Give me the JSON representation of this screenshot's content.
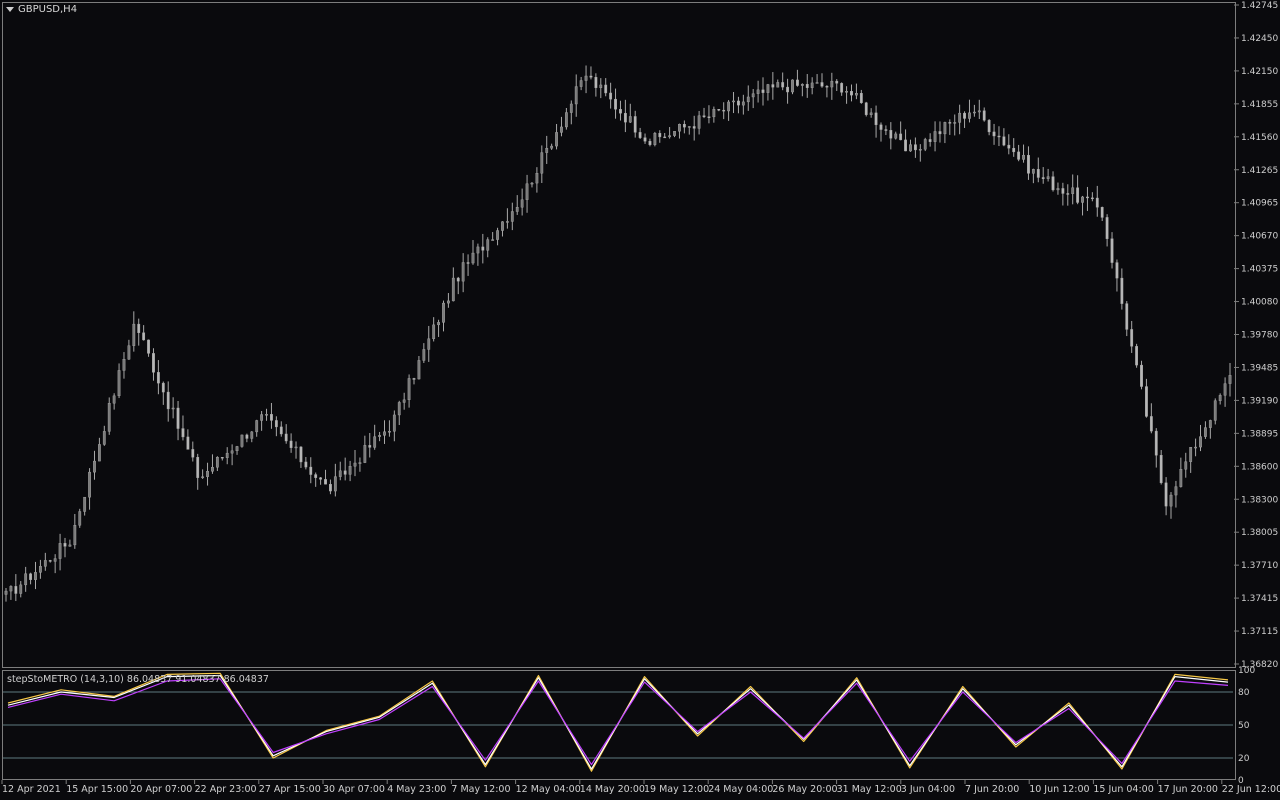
{
  "header": {
    "symbol_label": "GBPUSD,H4",
    "collapse_icon": "triangle-down-icon"
  },
  "indicator": {
    "label": "stepStoMETRO (14,3,10) 86.04837 91.04837 86.04837",
    "levels": [
      "100",
      "80",
      "50",
      "20",
      "0"
    ]
  },
  "price_axis": {
    "labels": [
      "1.42745",
      "1.42450",
      "1.42150",
      "1.41855",
      "1.41560",
      "1.41265",
      "1.40965",
      "1.40670",
      "1.40375",
      "1.40080",
      "1.39780",
      "1.39485",
      "1.39190",
      "1.38895",
      "1.38600",
      "1.38300",
      "1.38005",
      "1.37710",
      "1.37415",
      "1.37115",
      "1.36820"
    ]
  },
  "time_axis": {
    "labels": [
      "12 Apr 2021",
      "15 Apr 15:00",
      "20 Apr 07:00",
      "22 Apr 23:00",
      "27 Apr 15:00",
      "30 Apr 07:00",
      "4 May 23:00",
      "7 May 12:00",
      "12 May 04:00",
      "14 May 20:00",
      "19 May 12:00",
      "24 May 04:00",
      "26 May 20:00",
      "31 May 12:00",
      "3 Jun 04:00",
      "7 Jun 20:00",
      "10 Jun 12:00",
      "15 Jun 04:00",
      "17 Jun 20:00",
      "22 Jun 12:00"
    ]
  },
  "chart_data": [
    {
      "type": "candlestick",
      "title": "GBPUSD,H4",
      "ylim": [
        1.3682,
        1.42745
      ],
      "x": [
        "12 Apr 2021",
        "15 Apr 15:00",
        "20 Apr 07:00",
        "22 Apr 23:00",
        "27 Apr 15:00",
        "30 Apr 07:00",
        "4 May 23:00",
        "7 May 12:00",
        "12 May 04:00",
        "14 May 20:00",
        "19 May 12:00",
        "24 May 04:00",
        "26 May 20:00",
        "31 May 12:00",
        "3 Jun 04:00",
        "7 Jun 20:00",
        "10 Jun 12:00",
        "15 Jun 04:00",
        "17 Jun 20:00",
        "22 Jun 12:00"
      ],
      "close": [
        1.3745,
        1.3795,
        1.399,
        1.385,
        1.3905,
        1.384,
        1.39,
        1.403,
        1.41,
        1.421,
        1.415,
        1.4175,
        1.42,
        1.42,
        1.414,
        1.418,
        1.412,
        1.409,
        1.383,
        1.394
      ],
      "color": "#a9a9a9"
    },
    {
      "type": "line",
      "title": "stepStoMETRO (14,3,10) 86.04837 91.04837 86.04837",
      "ylim": [
        0,
        100
      ],
      "levels": [
        100,
        80,
        50,
        20,
        0
      ],
      "series": [
        {
          "color": "#f7c948",
          "values": [
            70,
            82,
            76,
            96,
            97,
            20,
            45,
            58,
            90,
            12,
            95,
            8,
            94,
            40,
            85,
            35,
            93,
            11,
            85,
            30,
            70,
            10,
            96,
            91
          ]
        },
        {
          "color": "#ffffff",
          "values": [
            68,
            80,
            75,
            94,
            95,
            22,
            44,
            57,
            88,
            14,
            93,
            10,
            92,
            42,
            83,
            37,
            91,
            13,
            83,
            32,
            68,
            12,
            94,
            89
          ]
        },
        {
          "color": "#c040ff",
          "values": [
            66,
            78,
            72,
            90,
            92,
            25,
            42,
            55,
            85,
            18,
            90,
            14,
            89,
            44,
            80,
            38,
            88,
            17,
            80,
            34,
            65,
            15,
            90,
            86
          ]
        }
      ],
      "colors": {
        "level_line": "#5f7b7e",
        "grid": "#7d7d7d"
      }
    }
  ],
  "colors": {
    "background": "#0a0a0d",
    "border": "#7d7d7d",
    "candle": "#a9a9a9",
    "level_line": "#5f7b7e",
    "text": "#cfcfcf",
    "line_yellow": "#f7c948",
    "line_white": "#ffffff",
    "line_magenta": "#c040ff"
  }
}
